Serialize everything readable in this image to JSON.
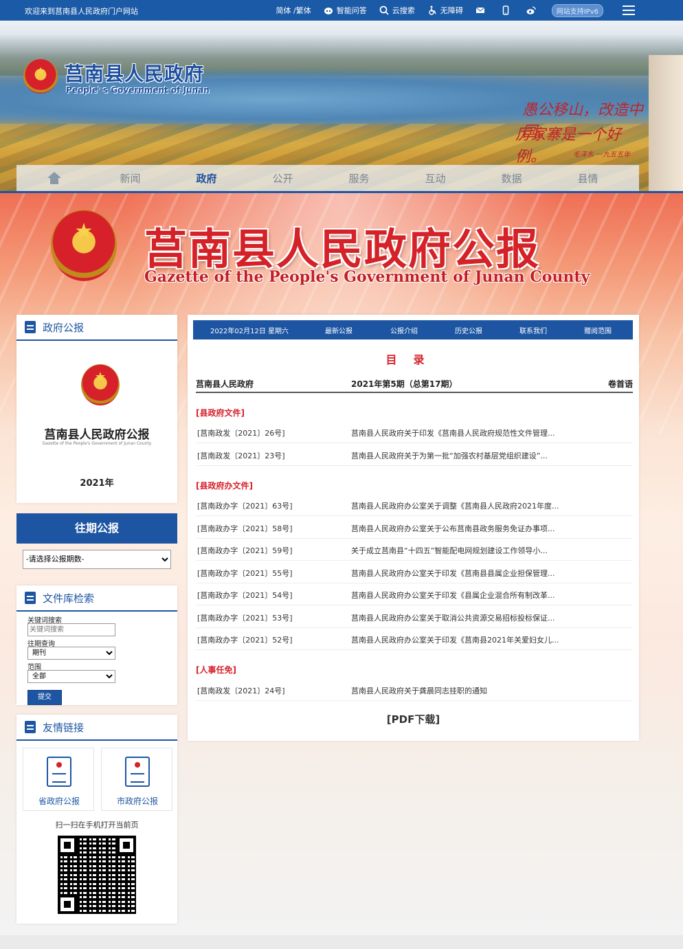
{
  "topbar": {
    "welcome": "欢迎来到莒南县人民政府门户网站",
    "lang": "简体 /繁体",
    "ai_qa": "智能问答",
    "search": "云搜索",
    "accessible": "无障碍",
    "ipv6": "网站支持IPv6"
  },
  "header": {
    "site_name": "莒南县人民政府",
    "site_name_en": "People' s Government of Junan",
    "calligraphy": [
      "愚公移山，改造中国。",
      "厉家寨是一个好例。",
      "毛泽东 一九五五年"
    ]
  },
  "nav": [
    "新闻",
    "政府",
    "公开",
    "服务",
    "互动",
    "数据",
    "县情"
  ],
  "nav_active": "政府",
  "gazette": {
    "title": "莒南县人民政府公报",
    "title_en": "Gazette of the People's Government of Junan County"
  },
  "sidebar": {
    "bulletin_title": "政府公报",
    "cover_title": "莒南县人民政府公报",
    "cover_en": "Gazette of the People's Government of Junan County",
    "cover_year": "2021年",
    "past_title": "往期公报",
    "past_select": "-请选择公报期数-",
    "search_title": "文件库检索",
    "kw_label": "关键词搜索",
    "kw_placeholder": "关键词搜索",
    "period_label": "往期查询",
    "period_value": "期刊",
    "range_label": "范围",
    "range_value": "全部",
    "submit": "提交",
    "links_title": "友情链接",
    "link_province": "省政府公报",
    "link_city": "市政府公报",
    "qr_label": "扫一扫在手机打开当前页"
  },
  "main": {
    "tabs": [
      "2022年02月12日 星期六",
      "最新公报",
      "公报介绍",
      "历史公报",
      "联系我们",
      "赠阅范围"
    ],
    "heading": "目录",
    "issuer": "莒南县人民政府",
    "issue": "2021年第5期（总第17期）",
    "preface": "卷首语",
    "sections": [
      {
        "title": "[县政府文件]",
        "items": [
          {
            "no": "[莒南政发〔2021〕26号]",
            "title": "莒南县人民政府关于印发《莒南县人民政府规范性文件管理..."
          },
          {
            "no": "[莒南政发〔2021〕23号]",
            "title": "莒南县人民政府关于为第一批“加强农村基层党组织建设”..."
          }
        ]
      },
      {
        "title": "[县政府办文件]",
        "items": [
          {
            "no": "[莒南政办字〔2021〕63号]",
            "title": "莒南县人民政府办公室关于调整《莒南县人民政府2021年度..."
          },
          {
            "no": "[莒南政办字〔2021〕58号]",
            "title": "莒南县人民政府办公室关于公布莒南县政务服务免证办事项..."
          },
          {
            "no": "[莒南政办字〔2021〕59号]",
            "title": "关于成立莒南县“十四五”智能配电网规划建设工作领导小..."
          },
          {
            "no": "[莒南政办字〔2021〕55号]",
            "title": "莒南县人民政府办公室关于印发《莒南县县属企业担保管理..."
          },
          {
            "no": "[莒南政办字〔2021〕54号]",
            "title": "莒南县人民政府办公室关于印发《县属企业混合所有制改革..."
          },
          {
            "no": "[莒南政办字〔2021〕53号]",
            "title": "莒南县人民政府办公室关于取消公共资源交易招标投标保证..."
          },
          {
            "no": "[莒南政办字〔2021〕52号]",
            "title": "莒南县人民政府办公室关于印发《莒南县2021年关爱妇女儿..."
          }
        ]
      },
      {
        "title": "[人事任免]",
        "items": [
          {
            "no": "[莒南政发〔2021〕24号]",
            "title": "莒南县人民政府关于龚晨同志挂职的通知"
          }
        ]
      }
    ],
    "pdf": "[PDF下载]"
  },
  "colors": {
    "primary": "#1d55a2",
    "accent": "#d6212b"
  }
}
